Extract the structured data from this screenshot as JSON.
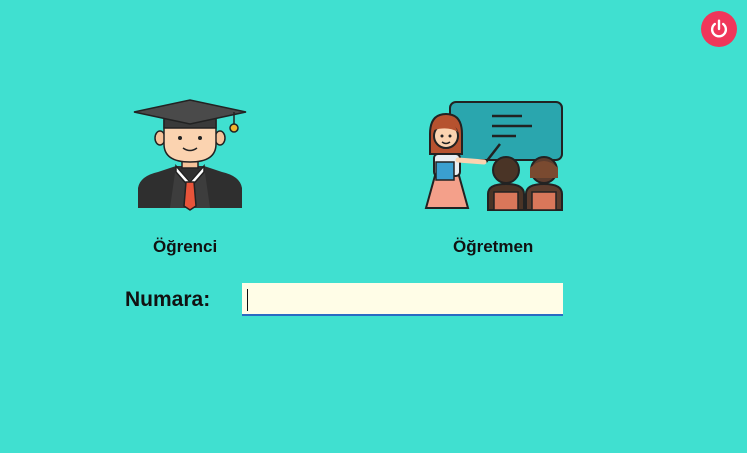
{
  "power_button": {
    "icon": "power-icon",
    "color": "#f0365a"
  },
  "roles": [
    {
      "label": "Öğrenci",
      "icon": "student-graduate-icon"
    },
    {
      "label": "Öğretmen",
      "icon": "teacher-classroom-icon"
    }
  ],
  "numara": {
    "label": "Numara:",
    "value": "",
    "placeholder": ""
  },
  "colors": {
    "background": "#40e0d0",
    "input_background": "#fffde7",
    "input_underline": "#2a6bc2"
  }
}
